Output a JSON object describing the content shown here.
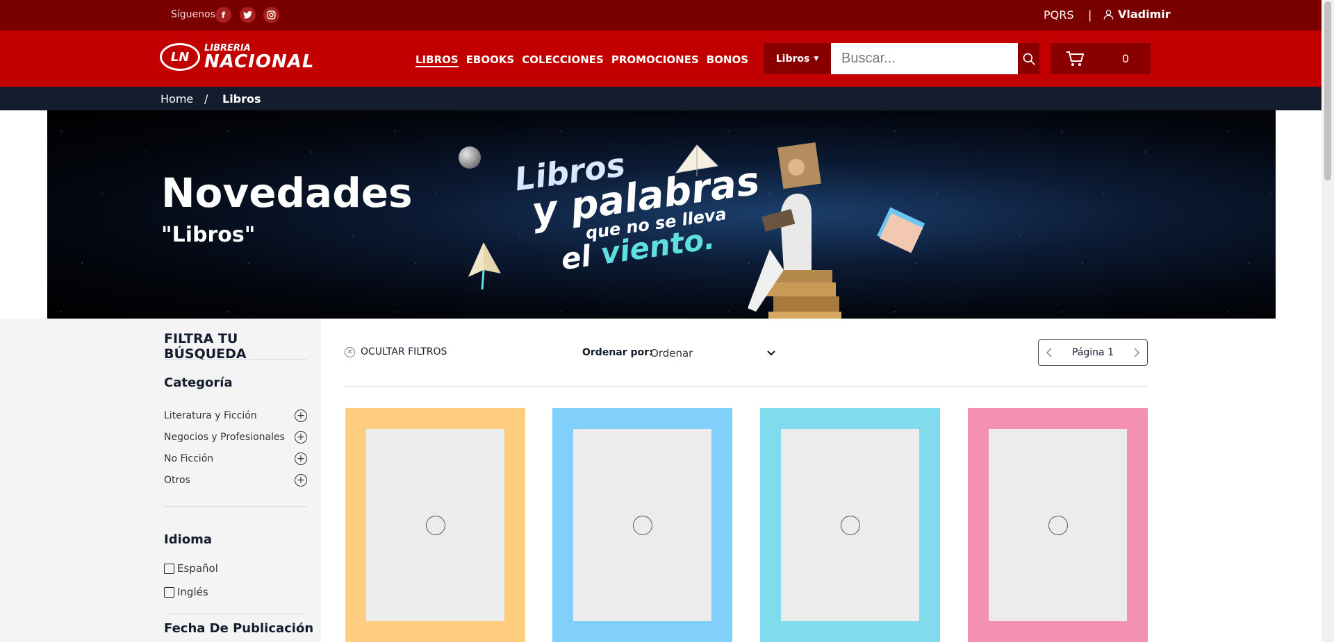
{
  "topbar": {
    "follow_label": "Síguenos",
    "social_icons": [
      "facebook-icon",
      "twitter-icon",
      "instagram-icon"
    ],
    "pqrs": "PQRS",
    "separator": "|",
    "user_name": "Vladimir"
  },
  "header": {
    "logo_line1": "LIBRERIA",
    "logo_line2": "NACIONAL",
    "nav": [
      "LIBROS",
      "EBOOKS",
      "COLECCIONES",
      "PROMOCIONES",
      "BONOS"
    ],
    "active_nav": "LIBROS",
    "category_selector": "Libros",
    "search_placeholder": "Buscar...",
    "cart_count": "0"
  },
  "breadcrumb": {
    "items": [
      "Home",
      "Libros"
    ],
    "separator": "/"
  },
  "banner": {
    "title": "Novedades",
    "subtitle": "\"Libros\"",
    "slogan_line1": "Libros",
    "slogan_line2": "y palabras",
    "slogan_line3_a": "que no se",
    "slogan_line3_b": "lleva",
    "slogan_line4_a": "el",
    "slogan_line4_b": "viento."
  },
  "sidebar": {
    "title": "FILTRA TU BÚSQUEDA",
    "category_heading": "Categoría",
    "categories": [
      "Literatura y Ficción",
      "Negocios y Profesionales",
      "No Ficción",
      "Otros"
    ],
    "language_heading": "Idioma",
    "languages": [
      "Español",
      "Inglés"
    ],
    "date_heading": "Fecha De Publicación"
  },
  "toolbar": {
    "hide_filters": "OCULTAR FILTROS",
    "sort_label": "Ordenar por:",
    "sort_value": "Ordenar",
    "page_label": "Página 1"
  },
  "products": {
    "card_colors": [
      "#ffcd80",
      "#80d0fb",
      "#80dced",
      "#f490b3"
    ]
  },
  "colors": {
    "topbar": "#7a0000",
    "header": "#c20000",
    "breadcrumb": "#141d2e"
  }
}
